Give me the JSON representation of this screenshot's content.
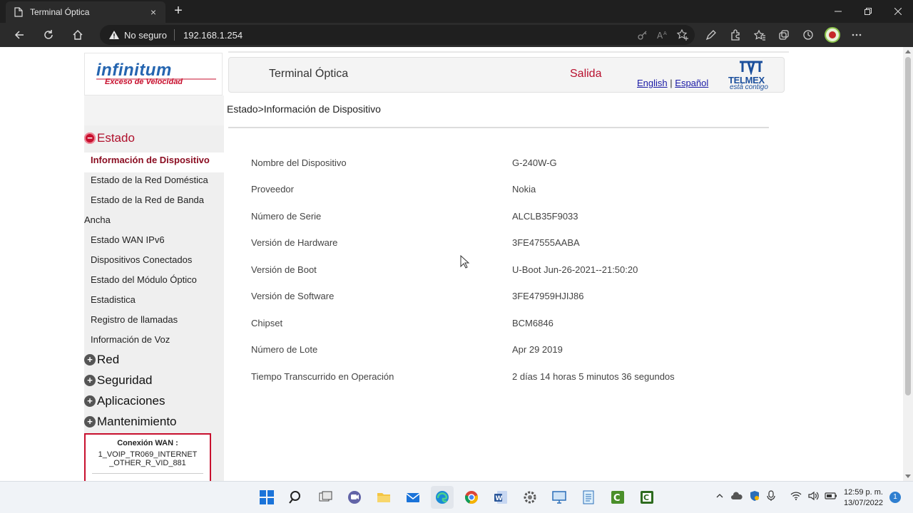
{
  "browser": {
    "tab_title": "Terminal Óptica",
    "tab_close": "×",
    "new_tab": "+",
    "security_label": "No seguro",
    "url": "192.168.1.254"
  },
  "header": {
    "logo_text": "infinitum",
    "logo_tagline": "Exceso de Velocidad",
    "title": "Terminal Óptica",
    "exit": "Salida",
    "lang_en": "English",
    "lang_sep": "|",
    "lang_es": "Español",
    "telmex": "TELMEX",
    "telmex_tagline": "está contigo"
  },
  "sidebar": {
    "sections": {
      "estado": "Estado",
      "red": "Red",
      "seguridad": "Seguridad",
      "aplicaciones": "Aplicaciones",
      "mantenimiento": "Mantenimiento"
    },
    "items": [
      "Información de Dispositivo",
      "Estado de la Red Doméstica",
      "Estado de la Red de Banda",
      "Ancha",
      "Estado WAN IPv6",
      "Dispositivos Conectados",
      "Estado del Módulo Óptico",
      "Estadistica",
      "Registro de llamadas",
      "Información de Voz"
    ],
    "wan": {
      "title": "Conexión WAN :",
      "line1": "1_VOIP_TR069_INTERNET",
      "line2": "_OTHER_R_VID_881"
    }
  },
  "main": {
    "breadcrumb": "Estado>Información de Dispositivo",
    "rows": [
      {
        "label": "Nombre del Dispositivo",
        "value": "G-240W-G"
      },
      {
        "label": "Proveedor",
        "value": "Nokia"
      },
      {
        "label": "Número de Serie",
        "value": "ALCLB35F9033"
      },
      {
        "label": "Versión de Hardware",
        "value": "3FE47555AABA"
      },
      {
        "label": "Versión de Boot",
        "value": "U-Boot Jun-26-2021--21:50:20"
      },
      {
        "label": "Versión de Software",
        "value": "3FE47959HJIJ86"
      },
      {
        "label": "Chipset",
        "value": "BCM6846"
      },
      {
        "label": "Número de Lote",
        "value": "Apr 29 2019"
      },
      {
        "label": "Tiempo Transcurrido en Operación",
        "value": "2 días 14 horas 5 minutos 36 segundos"
      }
    ]
  },
  "taskbar": {
    "time": "12:59 p. m.",
    "date": "13/07/2022",
    "notifications": "1"
  },
  "colors": {
    "accent_red": "#c8102e",
    "link_blue": "#1a1aa6",
    "brand_blue": "#2565b0"
  }
}
